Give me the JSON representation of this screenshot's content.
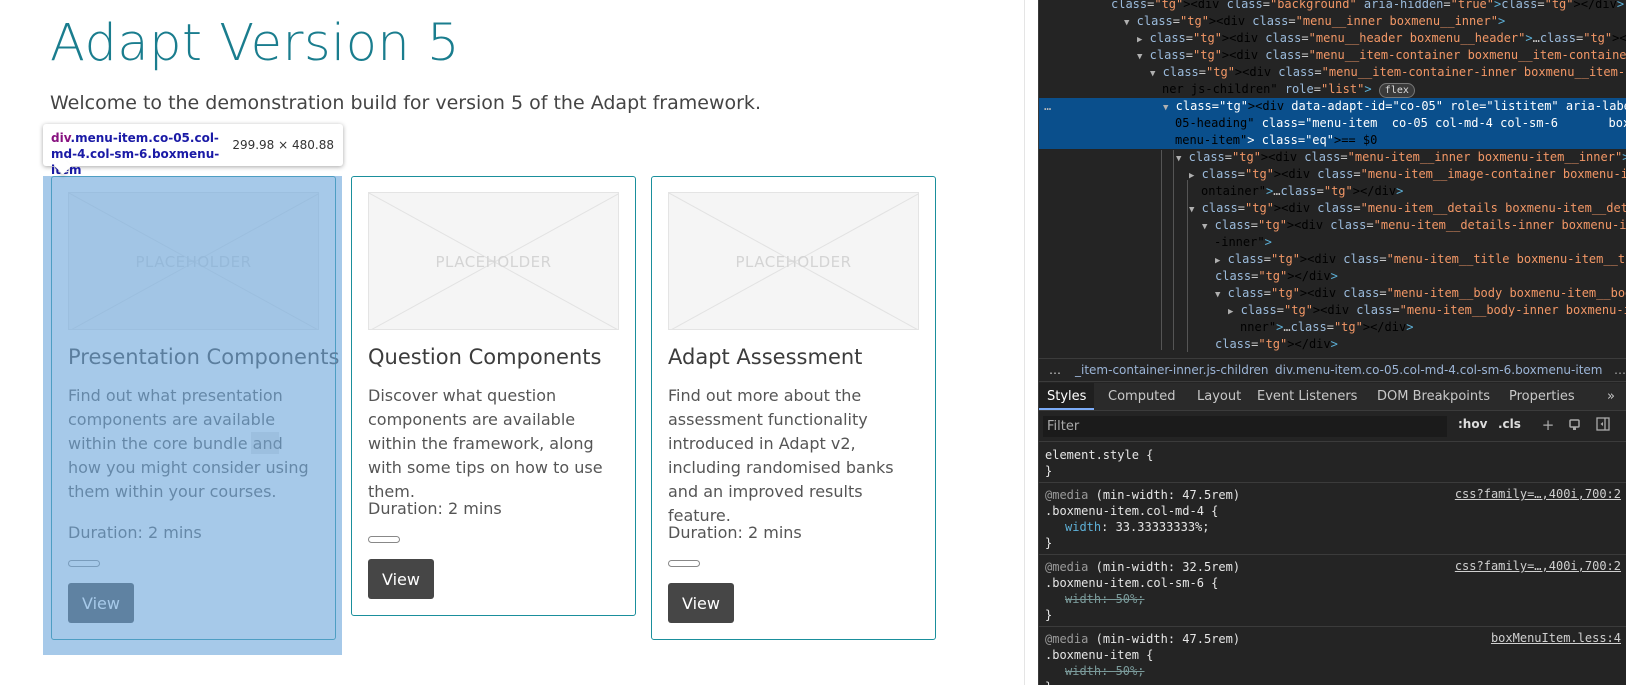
{
  "page": {
    "title": "Adapt Version 5",
    "intro": "Welcome to the demonstration build for version 5 of the Adapt framework.",
    "placeholder_text": "PLACEHOLDER",
    "cards": [
      {
        "title": "Presentation Components",
        "body": "Find out what presentation components are available within the core bundle and how you might consider using them within your courses.",
        "duration": "Duration: 2 mins",
        "button": "View",
        "progress": 0
      },
      {
        "title": "Question Components",
        "body": "Discover what question components are available within the framework, along with some tips on how to use them.",
        "duration": "Duration: 2 mins",
        "button": "View",
        "progress": 0
      },
      {
        "title": "Adapt Assessment",
        "body": "Find out more about the assessment functionality introduced in Adapt v2, including randomised banks and an improved results feature.",
        "duration": "Duration: 2 mins",
        "button": "View",
        "progress": 0
      }
    ]
  },
  "inspector_tooltip": {
    "tag": "div",
    "selector": ".menu-item.co-05.col-md-4.col-sm-6.boxmenu-item",
    "size": "299.98 × 480.88"
  },
  "devtools": {
    "dom_lines": [
      {
        "indent": 0,
        "tri": "",
        "html": "<div class=\"background\" aria-hidden=\"true\"></div>"
      },
      {
        "indent": 1,
        "tri": "▼",
        "html": "<div class=\"menu__inner boxmenu__inner\">"
      },
      {
        "indent": 2,
        "tri": "▶",
        "html": "<div class=\"menu__header boxmenu__header\">…</div>"
      },
      {
        "indent": 2,
        "tri": "▼",
        "html": "<div class=\"menu__item-container boxmenu__item-container\">"
      },
      {
        "indent": 3,
        "tri": "▼",
        "html": "<div class=\"menu__item-container-inner boxmenu__item-container-in"
      },
      {
        "indent": 3,
        "tri": "",
        "html": "ner js-children\" role=\"list\">"
      },
      {
        "indent": 4,
        "tri": "▼",
        "html": "<div data-adapt-id=\"co-05\" role=\"listitem\" aria-labelledby=\"co-"
      },
      {
        "indent": 4,
        "tri": "",
        "html": "05-heading\" class=\"menu-item  co-05 col-md-4 col-sm-6       box"
      },
      {
        "indent": 4,
        "tri": "",
        "html": "menu-item\"> == $0"
      },
      {
        "indent": 5,
        "tri": "▼",
        "html": "<div class=\"menu-item__inner boxmenu-item__inner\">"
      },
      {
        "indent": 6,
        "tri": "▶",
        "html": "<div class=\"menu-item__image-container boxmenu-item__image-c"
      },
      {
        "indent": 6,
        "tri": "",
        "html": "ontainer\">…</div>"
      },
      {
        "indent": 6,
        "tri": "▼",
        "html": "<div class=\"menu-item__details boxmenu-item__details\">"
      },
      {
        "indent": 7,
        "tri": "▼",
        "html": "<div class=\"menu-item__details-inner boxmenu-item__details"
      },
      {
        "indent": 7,
        "tri": "",
        "html": "-inner\">"
      },
      {
        "indent": 8,
        "tri": "▶",
        "html": "<div class=\"menu-item__title boxmenu-item__title\">…"
      },
      {
        "indent": 8,
        "tri": "",
        "html": "</div>"
      },
      {
        "indent": 8,
        "tri": "▼",
        "html": "<div class=\"menu-item__body boxmenu-item__body\">"
      },
      {
        "indent": 9,
        "tri": "▶",
        "html": "<div class=\"menu-item__body-inner boxmenu-item__body-i"
      },
      {
        "indent": 9,
        "tri": "",
        "html": "nner\">…</div>"
      },
      {
        "indent": 8,
        "tri": "",
        "html": "</div>"
      }
    ],
    "flex_badge": "flex",
    "dom_ellipsis": "…",
    "breadcrumbs": {
      "dots": "…",
      "a": "_item-container-inner.js-children",
      "b": "div.menu-item.co-05.col-md-4.col-sm-6.boxmenu-item",
      "end": "…"
    },
    "tabs": [
      "Styles",
      "Computed",
      "Layout",
      "Event Listeners",
      "DOM Breakpoints",
      "Properties"
    ],
    "tabs_more": "»",
    "filter_placeholder": "Filter",
    "hov": ":hov",
    "cls": ".cls",
    "rules": [
      {
        "media": "",
        "selector": "element.style {",
        "prop": "",
        "val": "",
        "strike": false,
        "source": ""
      },
      {
        "media": "(min-width: 47.5rem)",
        "selector": ".boxmenu-item.col-md-4 {",
        "prop": "width",
        "val": "33.33333333%;",
        "strike": false,
        "source": "css?family=…,400i,700:2"
      },
      {
        "media": "(min-width: 32.5rem)",
        "selector": ".boxmenu-item.col-sm-6 {",
        "prop": "width",
        "val": "50%;",
        "strike": true,
        "source": "css?family=…,400i,700:2"
      },
      {
        "media": "(min-width: 47.5rem)",
        "selector": ".boxmenu-item {",
        "prop": "width",
        "val": "50%;",
        "strike": true,
        "source": "boxMenuItem.less:4"
      }
    ]
  }
}
